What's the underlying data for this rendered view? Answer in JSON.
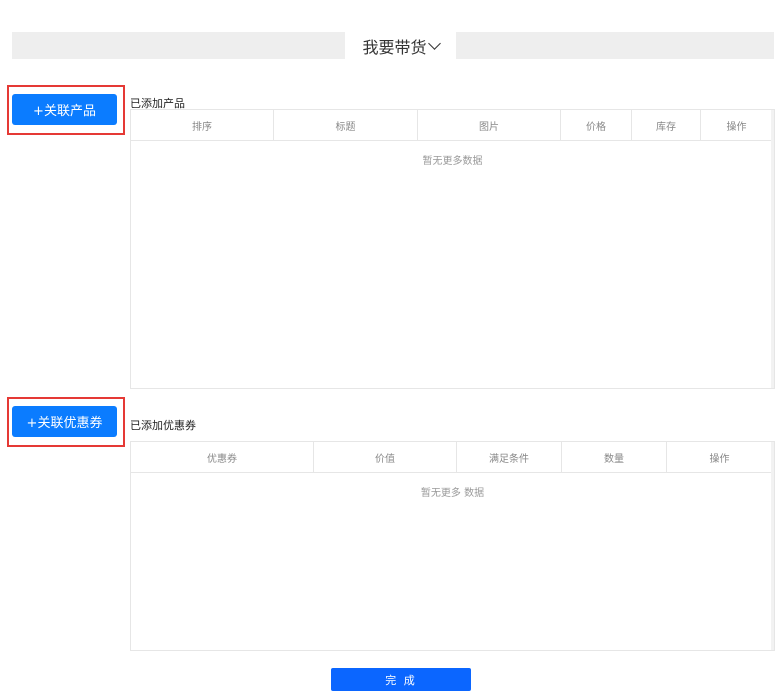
{
  "header": {
    "title": "我要带货"
  },
  "products": {
    "add_button": "+关联产品",
    "section_label": "已添加产品",
    "columns": [
      "排序",
      "标题",
      "图片",
      "价格",
      "库存",
      "操作"
    ],
    "empty_text": "暂无更多数据"
  },
  "coupons": {
    "add_button": "+关联优惠券",
    "section_label": "已添加优惠券",
    "columns": [
      "优惠券",
      "价值",
      "满足条件",
      "数量",
      "操作"
    ],
    "empty_text": "暂无更多 数据"
  },
  "footer": {
    "done_button": "完 成"
  },
  "colors": {
    "primary": "#0b7cff",
    "highlight": "#e53935"
  }
}
